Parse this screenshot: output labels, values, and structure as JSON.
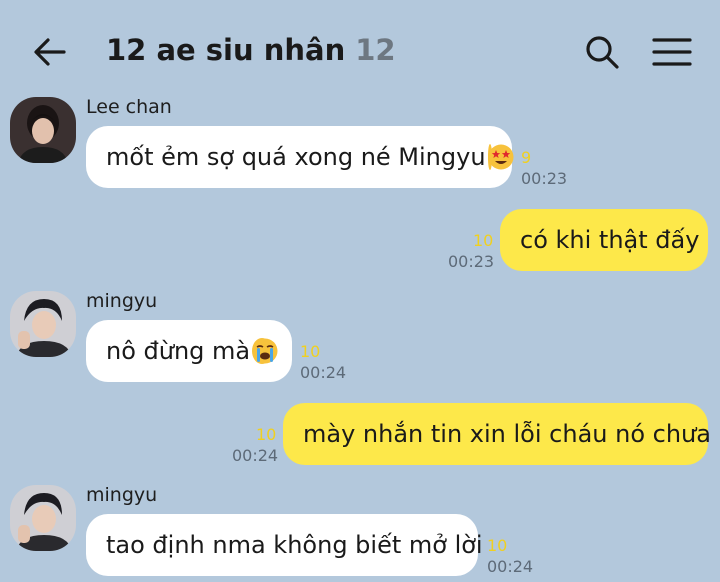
{
  "header": {
    "title": "12 ae siu nhân",
    "member_count": "12"
  },
  "messages": [
    {
      "sender": "Lee chan",
      "text": "mốt ẻm sợ quá xong né Mingyu",
      "emoji": "star-struck-emoji",
      "unread": "9",
      "time": "00:23"
    },
    {
      "text": "có khi thật đấy",
      "unread": "10",
      "time": "00:23"
    },
    {
      "sender": "mingyu",
      "text": "nô đừng mà",
      "emoji": "crying-emoji",
      "unread": "10",
      "time": "00:24"
    },
    {
      "text": "mày nhắn tin xin lỗi cháu nó chưa",
      "unread": "10",
      "time": "00:24"
    },
    {
      "sender": "mingyu",
      "text": "tao định nma không biết mở lời",
      "unread": "10",
      "time": "00:24"
    }
  ],
  "colors": {
    "background": "#b3c8dc",
    "incoming_bubble": "#ffffff",
    "outgoing_bubble": "#fde84a",
    "unread_count": "#f0d020"
  }
}
